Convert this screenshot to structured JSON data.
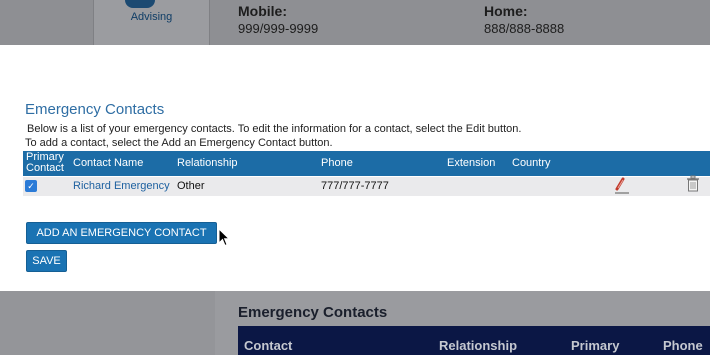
{
  "background_top": {
    "tile_label": "Advising",
    "fields": [
      {
        "label": "Mobile:",
        "value": "999/999-9999"
      },
      {
        "label": "Home:",
        "value": "888/888-8888"
      }
    ]
  },
  "modal": {
    "title": "Emergency Contacts",
    "instructions": [
      "Below is a list of your emergency contacts. To edit the information for a contact, select the Edit button.",
      "To add a contact, select the Add an Emergency Contact button."
    ],
    "table": {
      "headers": {
        "primary_line1": "Primary",
        "primary_line2": "Contact",
        "name": "Contact Name",
        "relationship": "Relationship",
        "phone": "Phone",
        "extension": "Extension",
        "country": "Country"
      },
      "rows": [
        {
          "primary": true,
          "name": "Richard Emergency",
          "relationship": "Other",
          "phone": "777/777-7777",
          "extension": "",
          "country": ""
        }
      ]
    },
    "add_button": "ADD AN EMERGENCY CONTACT",
    "save_button": "SAVE"
  },
  "background_bottom": {
    "title": "Emergency Contacts",
    "headers": [
      "Contact",
      "Relationship",
      "Primary",
      "Phone"
    ]
  },
  "colors": {
    "accent": "#1c6ca6",
    "link": "#1e61a0",
    "overlay": "#8e8f93",
    "dark_header": "#0b1745"
  },
  "icons": [
    "advising-icon",
    "checkbox-checked-icon",
    "edit-pencil-icon",
    "trash-icon",
    "mouse-cursor-icon"
  ]
}
